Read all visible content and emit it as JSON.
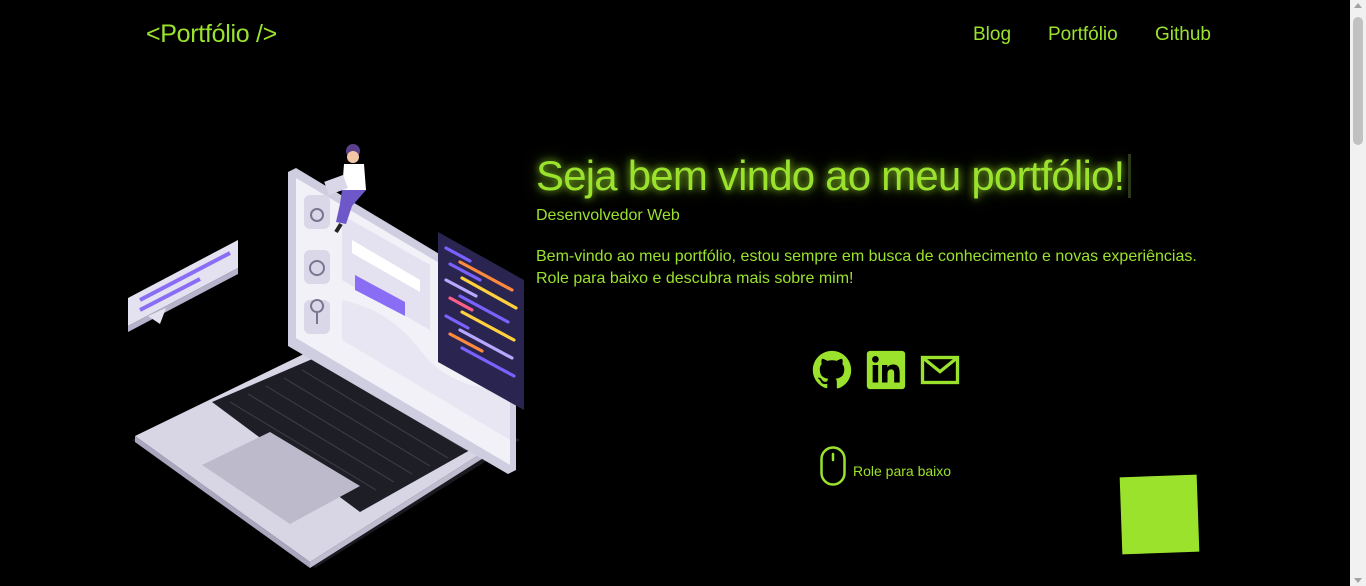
{
  "header": {
    "logo": "<Portfólio />",
    "nav": [
      {
        "label": "Blog"
      },
      {
        "label": "Portfólio"
      },
      {
        "label": "Github"
      }
    ]
  },
  "hero": {
    "headline": "Seja bem vindo ao meu portfólio!",
    "subtitle": "Desenvolvedor Web",
    "bio": "Bem-vindo ao meu portfólio, estou sempre em busca de conhecimento e novas experiências. Role para baixo e descubra mais sobre mim!",
    "illustration": "developer-laptop-illustration"
  },
  "socials": [
    {
      "icon": "github-icon"
    },
    {
      "icon": "linkedin-icon"
    },
    {
      "icon": "mail-icon"
    }
  ],
  "scroll_hint": {
    "icon": "mouse-icon",
    "label": "Role para baixo"
  },
  "colors": {
    "background": "#000000",
    "accent": "#9be22d",
    "illustration_purple": "#7b61ff"
  }
}
